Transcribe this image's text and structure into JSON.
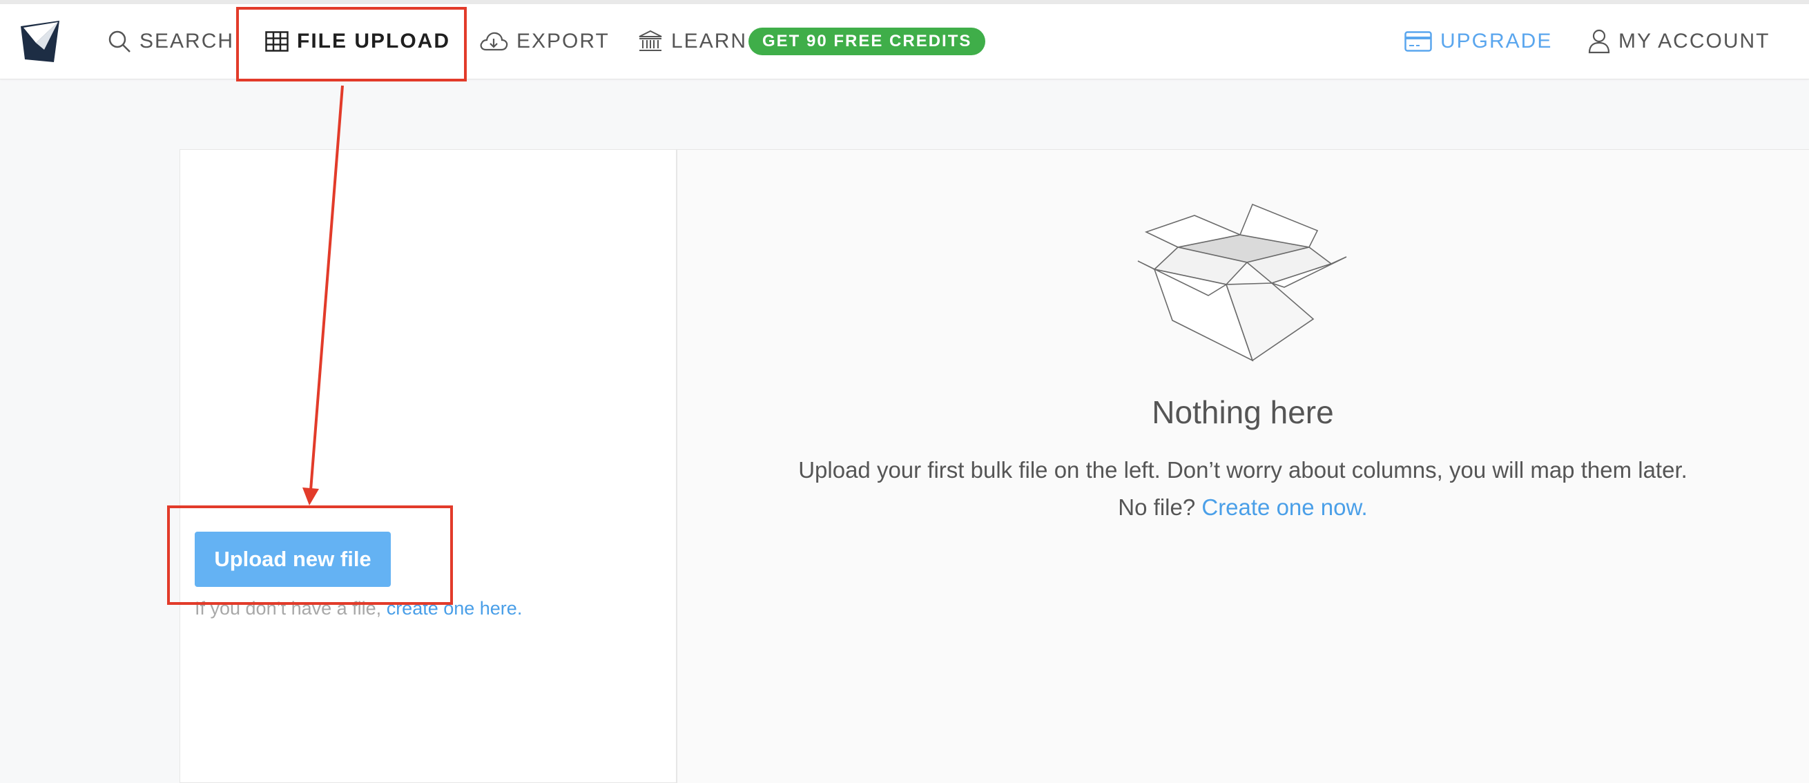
{
  "nav": {
    "search_label": "SEARCH",
    "file_upload_label": "FILE UPLOAD",
    "export_label": "EXPORT",
    "learn_label": "LEARN",
    "credits_badge": "GET 90 FREE CREDITS",
    "upgrade_label": "UPGRADE",
    "account_label": "MY ACCOUNT"
  },
  "upload_panel": {
    "button_label": "Upload new file",
    "hint_text": "If you don’t have a file, ",
    "hint_link": "create one here."
  },
  "empty_state": {
    "title": "Nothing here",
    "description": "Upload your first bulk file on the left. Don’t worry about columns, you will map them later.",
    "prompt": "No file? ",
    "link": "Create one now."
  },
  "colors": {
    "accent_blue": "#64b2f3",
    "link_blue": "#4a9fe8",
    "badge_green": "#3fae49",
    "annotation_red": "#e23b2a",
    "highlight_yellow": "#f4ef3a"
  },
  "icons": [
    "logo-icon",
    "search-icon",
    "table-icon",
    "cloud-download-icon",
    "bank-icon",
    "credit-card-icon",
    "user-icon",
    "open-box-icon"
  ]
}
